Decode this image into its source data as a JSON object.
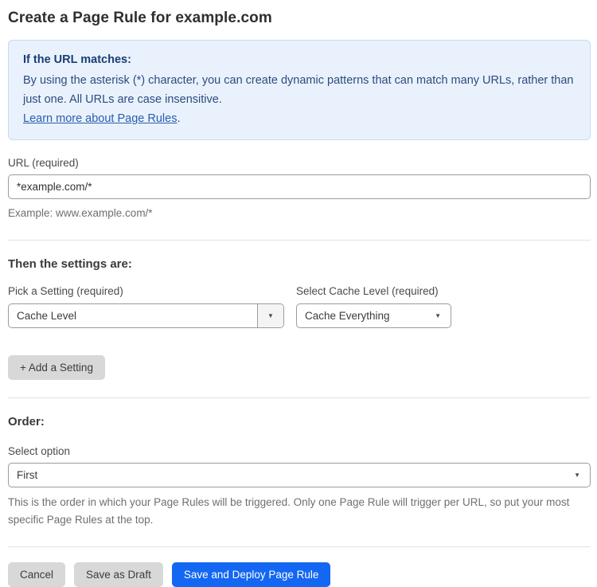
{
  "page": {
    "title": "Create a Page Rule for example.com"
  },
  "info_box": {
    "heading": "If the URL matches:",
    "body": "By using the asterisk (*) character, you can create dynamic patterns that can match many URLs, rather than just one. All URLs are case insensitive.",
    "link_label": "Learn more about Page Rules",
    "link_suffix": "."
  },
  "url_field": {
    "label": "URL (required)",
    "value": "*example.com/*",
    "helper": "Example: www.example.com/*"
  },
  "settings": {
    "heading": "Then the settings are:",
    "setting_picker": {
      "label": "Pick a Setting (required)",
      "value": "Cache Level"
    },
    "cache_level_picker": {
      "label": "Select Cache Level (required)",
      "value": "Cache Everything"
    },
    "add_setting_label": "+ Add a Setting"
  },
  "order": {
    "heading": "Order:",
    "select_label": "Select option",
    "value": "First",
    "helper": "This is the order in which your Page Rules will be triggered. Only one Page Rule will trigger per URL, so put your most specific Page Rules at the top."
  },
  "actions": {
    "cancel": "Cancel",
    "save_draft": "Save as Draft",
    "save_deploy": "Save and Deploy Page Rule"
  },
  "icons": {
    "dropdown_arrow": "▼"
  },
  "colors": {
    "primary_blue": "#1467f2",
    "info_bg": "#e9f2fc",
    "info_border": "#c5dcf4",
    "info_text": "#2d4b80",
    "link_blue": "#2a5db0",
    "button_gray": "#d8d8d8"
  }
}
